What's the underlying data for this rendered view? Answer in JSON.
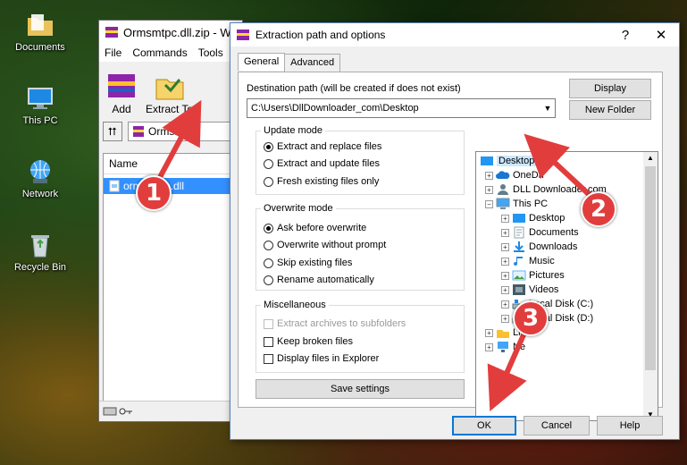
{
  "desktop": {
    "icons": [
      {
        "label": "Documents"
      },
      {
        "label": "This PC"
      },
      {
        "label": "Network"
      },
      {
        "label": "Recycle Bin"
      }
    ]
  },
  "winrar": {
    "title": "Ormsmtpc.dll.zip - W",
    "menu": [
      "File",
      "Commands",
      "Tools"
    ],
    "toolbar": {
      "add": "Add",
      "extract_to": "Extract To"
    },
    "address": "Ormsmtpc.",
    "column_name": "Name",
    "file": "ormsmtpc.dll"
  },
  "dialog": {
    "title": "Extraction path and options",
    "help_btn": "?",
    "close_btn": "✕",
    "tabs": [
      "General",
      "Advanced"
    ],
    "dest_label": "Destination path (will be created if does not exist)",
    "dest_value": "C:\\Users\\DllDownloader_com\\Desktop",
    "display_btn": "Display",
    "new_folder_btn": "New Folder",
    "update_mode": {
      "title": "Update mode",
      "options": [
        "Extract and replace files",
        "Extract and update files",
        "Fresh existing files only"
      ],
      "selected": 0
    },
    "overwrite_mode": {
      "title": "Overwrite mode",
      "options": [
        "Ask before overwrite",
        "Overwrite without prompt",
        "Skip existing files",
        "Rename automatically"
      ],
      "selected": 0
    },
    "misc": {
      "title": "Miscellaneous",
      "options": [
        "Extract archives to subfolders",
        "Keep broken files",
        "Display files in Explorer"
      ]
    },
    "save_settings": "Save settings",
    "tree": {
      "desktop": "Desktop",
      "onedrive": "OneDri",
      "dlldownloader": "DLL Downloader.com",
      "this_pc": "This PC",
      "pc_items": [
        "Desktop",
        "Documents",
        "Downloads",
        "Music",
        "Pictures",
        "Videos",
        "Local Disk (C:)",
        "Local Disk (D:)"
      ],
      "libraries": "Lib",
      "network": "Ne"
    },
    "ok": "OK",
    "cancel": "Cancel",
    "help": "Help"
  },
  "annotations": [
    "1",
    "2",
    "3"
  ],
  "colors": {
    "selection": "#3390ff",
    "callout": "#e23d3d",
    "tree_highlight": "#cce8ff"
  }
}
